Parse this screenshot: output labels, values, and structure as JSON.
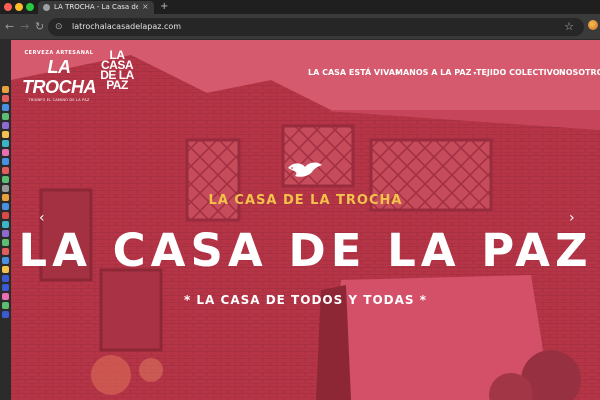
{
  "browser": {
    "tab_title": "LA TROCHA - La Casa de la",
    "tab_close": "×",
    "new_tab": "+",
    "url": "latrochalacasadelapaz.com",
    "back": "←",
    "forward": "→",
    "reload": "↻",
    "site_info": "⊙",
    "bookmark": "☆"
  },
  "logo": {
    "trocha_top": "CERVEZA ARTESANAL",
    "trocha_main": "LA TROCHA",
    "trocha_bottom": "TRIUNFO EL CAMINO DE LA PAZ",
    "casa_line1": "LA",
    "casa_line2": "CASA",
    "casa_line3": "DE LA",
    "casa_line4": "PAZ"
  },
  "nav": {
    "items": [
      {
        "label": "LA CASA ESTÁ VIVA",
        "caret": "▾"
      },
      {
        "label": "MANOS A LA PAZ",
        "caret": "▾"
      },
      {
        "label": "TEJIDO COLECTIVO",
        "caret": "▾"
      },
      {
        "label": "NOSOTROS",
        "caret": ""
      }
    ]
  },
  "hero": {
    "eyebrow": "LA CASA DE LA TROCHA",
    "title": "LA CASA DE LA PAZ",
    "subtitle": "* LA CASA DE TODOS Y TODAS *",
    "prev": "‹",
    "next": "›"
  },
  "colors": {
    "overlay": "#cd3c55",
    "eyebrow": "#f4c24a",
    "text": "#ffffff"
  }
}
